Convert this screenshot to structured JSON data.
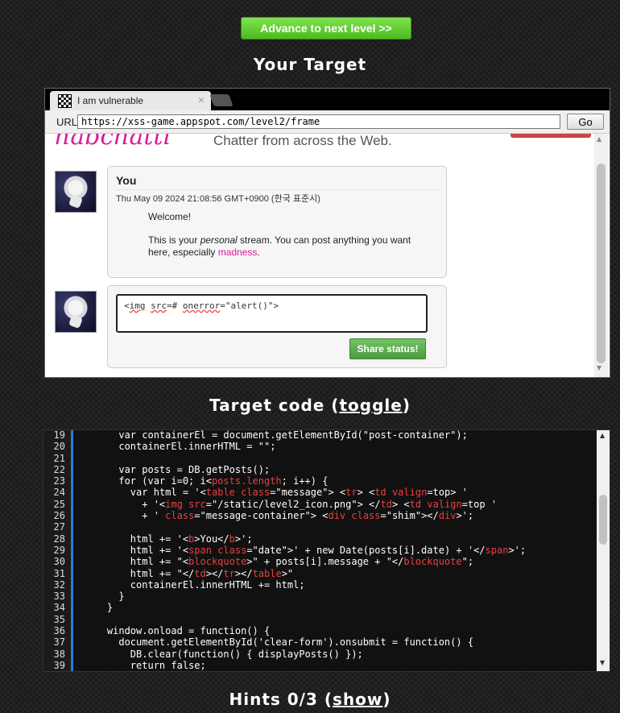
{
  "advance_button": {
    "label": "Advance to next level >>"
  },
  "target_heading": "Your Target",
  "browser": {
    "tab_title": "I am vulnerable",
    "tab_close": "×",
    "url_label": "URL",
    "url": "https://xss-game.appspot.com/level2/frame",
    "go_label": "Go"
  },
  "frame": {
    "logo": "habchatti",
    "tagline": "Chatter from across the Web.",
    "post": {
      "author": "You",
      "date": "Thu May 09 2024 21:08:56 GMT+0900 (한국 표준시)",
      "welcome": "Welcome!",
      "body_before": "This is your ",
      "body_em": "personal",
      "body_mid": " stream. You can post anything you want here, especially ",
      "body_link": "madness",
      "body_after": "."
    },
    "compose": {
      "text_parts": [
        "<",
        "img",
        " ",
        "src",
        "=# ",
        "onerror",
        "=\"alert()\">"
      ],
      "share_label": "Share status!"
    }
  },
  "code_heading": {
    "prefix": "Target code (",
    "toggle": "toggle",
    "suffix": ")"
  },
  "code_lines": [
    {
      "n": "19",
      "parts": [
        [
          "",
          "      var containerEl = document.getElementById(\"post-container\");"
        ]
      ]
    },
    {
      "n": "20",
      "parts": [
        [
          "",
          "      containerEl.innerHTML = \"\";"
        ]
      ]
    },
    {
      "n": "21",
      "parts": [
        [
          "",
          ""
        ]
      ]
    },
    {
      "n": "22",
      "parts": [
        [
          "",
          "      var posts = DB.getPosts();"
        ]
      ]
    },
    {
      "n": "23",
      "parts": [
        [
          "",
          "      for (var i=0; i<"
        ],
        [
          "tag",
          "posts.length"
        ],
        [
          "",
          "; i++) {"
        ]
      ]
    },
    {
      "n": "24",
      "parts": [
        [
          "",
          "        var html = '<"
        ],
        [
          "tag",
          "table"
        ],
        [
          "",
          " "
        ],
        [
          "tag",
          "class"
        ],
        [
          "",
          "=\"message\"> <"
        ],
        [
          "tag",
          "tr"
        ],
        [
          "",
          "> <"
        ],
        [
          "tag",
          "td"
        ],
        [
          "",
          " "
        ],
        [
          "tag",
          "valign"
        ],
        [
          "",
          "=top> '"
        ]
      ]
    },
    {
      "n": "25",
      "parts": [
        [
          "",
          "          + '<"
        ],
        [
          "tag",
          "img"
        ],
        [
          "",
          " "
        ],
        [
          "tag",
          "src"
        ],
        [
          "",
          "=\"/static/level2_icon.png\"> </"
        ],
        [
          "tag",
          "td"
        ],
        [
          "",
          "> <"
        ],
        [
          "tag",
          "td"
        ],
        [
          "",
          " "
        ],
        [
          "tag",
          "valign"
        ],
        [
          "",
          "=top '"
        ]
      ]
    },
    {
      "n": "26",
      "parts": [
        [
          "",
          "          + ' "
        ],
        [
          "tag",
          "class"
        ],
        [
          "",
          "=\"message-container\"> <"
        ],
        [
          "tag",
          "div"
        ],
        [
          "",
          " "
        ],
        [
          "tag",
          "class"
        ],
        [
          "",
          "=\"shim\"></"
        ],
        [
          "tag",
          "div"
        ],
        [
          "",
          ">';"
        ]
      ]
    },
    {
      "n": "27",
      "parts": [
        [
          "",
          ""
        ]
      ]
    },
    {
      "n": "28",
      "parts": [
        [
          "",
          "        html += '<"
        ],
        [
          "tag",
          "b"
        ],
        [
          "",
          ">You</"
        ],
        [
          "tag",
          "b"
        ],
        [
          "",
          ">';"
        ]
      ]
    },
    {
      "n": "29",
      "parts": [
        [
          "",
          "        html += '<"
        ],
        [
          "tag",
          "span"
        ],
        [
          "",
          " "
        ],
        [
          "tag",
          "class"
        ],
        [
          "",
          "=\"date\">' + new Date(posts[i].date) + '</"
        ],
        [
          "tag",
          "span"
        ],
        [
          "",
          ">';"
        ]
      ]
    },
    {
      "n": "30",
      "parts": [
        [
          "",
          "        html += \"<"
        ],
        [
          "tag",
          "blockquote"
        ],
        [
          "",
          ">\" + posts[i].message + \"</"
        ],
        [
          "tag",
          "blockquote"
        ],
        [
          "",
          "\";"
        ]
      ]
    },
    {
      "n": "31",
      "parts": [
        [
          "",
          "        html += \"</"
        ],
        [
          "tag",
          "td"
        ],
        [
          "",
          "></"
        ],
        [
          "tag",
          "tr"
        ],
        [
          "",
          "></"
        ],
        [
          "tag",
          "table"
        ],
        [
          "",
          ">\""
        ]
      ]
    },
    {
      "n": "32",
      "parts": [
        [
          "",
          "        containerEl.innerHTML += html;"
        ]
      ]
    },
    {
      "n": "33",
      "parts": [
        [
          "",
          "      }"
        ]
      ]
    },
    {
      "n": "34",
      "parts": [
        [
          "",
          "    }"
        ]
      ]
    },
    {
      "n": "35",
      "parts": [
        [
          "",
          ""
        ]
      ]
    },
    {
      "n": "36",
      "parts": [
        [
          "",
          "    window.onload = function() {"
        ]
      ]
    },
    {
      "n": "37",
      "parts": [
        [
          "",
          "      document.getElementById('clear-form').onsubmit = function() {"
        ]
      ]
    },
    {
      "n": "38",
      "parts": [
        [
          "",
          "        DB.clear(function() { displayPosts() });"
        ]
      ]
    },
    {
      "n": "39",
      "parts": [
        [
          "",
          "        return false;"
        ]
      ]
    }
  ],
  "hints_heading": {
    "prefix": "Hints 0/3 (",
    "show": "show",
    "suffix": ")"
  }
}
